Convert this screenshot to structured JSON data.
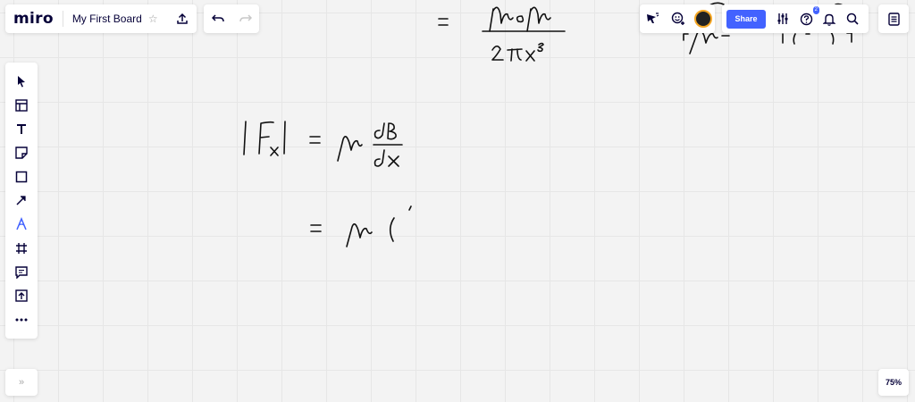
{
  "app": {
    "logo": "miro",
    "board_title": "My First Board"
  },
  "header": {
    "share_label": "Share",
    "help_badge": "2"
  },
  "zoom": {
    "level": "75%"
  },
  "icons": {
    "star": "star-icon",
    "upload": "upload-icon",
    "undo": "undo-icon",
    "redo": "redo-icon",
    "cursor_reactions": "reactions-cursor-icon",
    "collaborators": "add-collaborator-icon",
    "settings": "settings-sliders-icon",
    "help": "help-icon",
    "notifications": "bell-icon",
    "search": "search-icon",
    "notes_panel": "board-menu-icon"
  },
  "toolbar": {
    "tools": [
      {
        "name": "select-tool",
        "icon": "cursor-arrow-icon",
        "active": false
      },
      {
        "name": "templates-tool",
        "icon": "template-icon",
        "active": false
      },
      {
        "name": "text-tool",
        "icon": "text-icon",
        "active": false
      },
      {
        "name": "sticky-note-tool",
        "icon": "sticky-note-icon",
        "active": false
      },
      {
        "name": "shape-tool",
        "icon": "square-icon",
        "active": false
      },
      {
        "name": "arrow-tool",
        "icon": "arrow-icon",
        "active": false
      },
      {
        "name": "pen-tool",
        "icon": "pen-icon",
        "active": true
      },
      {
        "name": "frame-tool",
        "icon": "frame-icon",
        "active": false
      },
      {
        "name": "comment-tool",
        "icon": "comment-icon",
        "active": false
      },
      {
        "name": "upload-tool",
        "icon": "upload-icon",
        "active": false
      },
      {
        "name": "more-tools",
        "icon": "more-icon",
        "active": false
      }
    ]
  },
  "colors": {
    "accent": "#4262ff",
    "ink": "#050038",
    "canvas": "#f3f3f3"
  },
  "expand_label": "»"
}
